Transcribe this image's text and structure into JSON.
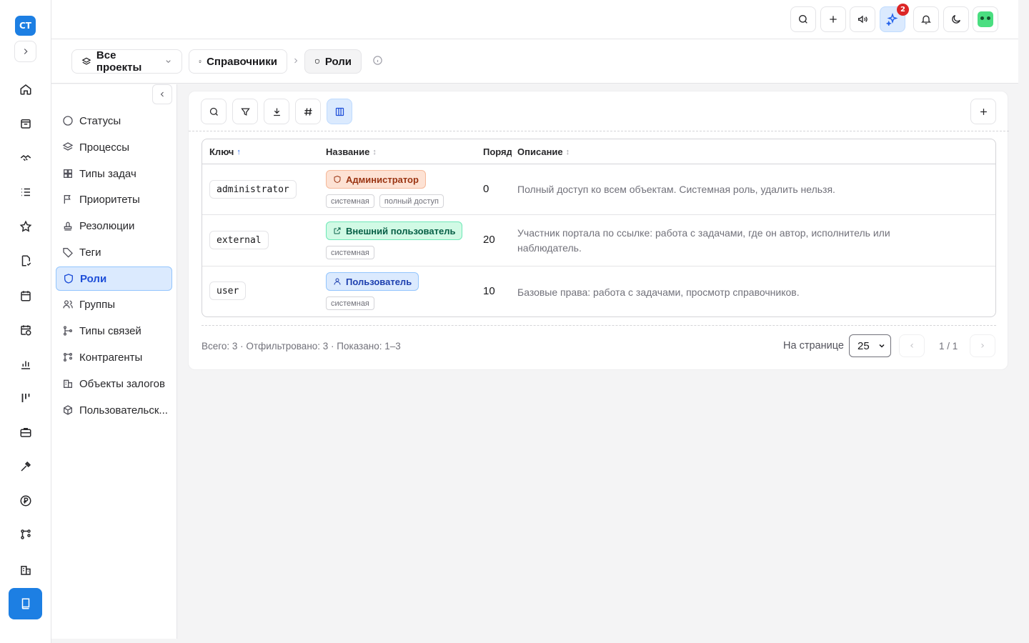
{
  "rail": {
    "logo": "CT",
    "icons": [
      "home-icon",
      "inbox-icon",
      "handshake-icon",
      "list-icon",
      "star-icon",
      "document-check-icon",
      "calendar-icon",
      "calendar-clock-icon",
      "bar-chart-icon",
      "kanban-icon",
      "briefcase-icon",
      "tools-icon",
      "ruble-icon",
      "nodes-icon",
      "building-icon"
    ],
    "active_icon": "book-icon"
  },
  "topbar": {
    "buttons": [
      "search-icon",
      "plus-icon",
      "megaphone-icon",
      "sparkles-icon",
      "bell-icon",
      "moon-icon"
    ],
    "ai_badge": "2"
  },
  "breadcrumb": {
    "projects": "Все проекты",
    "section": "Справочники",
    "current": "Роли"
  },
  "sidenav": {
    "items": [
      {
        "label": "Статусы",
        "icon": "circle-icon"
      },
      {
        "label": "Процессы",
        "icon": "layers-icon"
      },
      {
        "label": "Типы задач",
        "icon": "grid-icon"
      },
      {
        "label": "Приоритеты",
        "icon": "flag-icon"
      },
      {
        "label": "Резолюции",
        "icon": "stamp-icon"
      },
      {
        "label": "Теги",
        "icon": "tag-icon"
      },
      {
        "label": "Роли",
        "icon": "shield-icon",
        "active": true
      },
      {
        "label": "Группы",
        "icon": "users-icon"
      },
      {
        "label": "Типы связей",
        "icon": "git-branch-icon"
      },
      {
        "label": "Контрагенты",
        "icon": "nodes-icon"
      },
      {
        "label": "Объекты залогов",
        "icon": "building-icon"
      },
      {
        "label": "Пользовательск...",
        "icon": "box-icon"
      }
    ]
  },
  "table": {
    "headers": {
      "key": "Ключ",
      "name": "Название",
      "order": "Поряд",
      "desc": "Описание"
    },
    "rows": [
      {
        "key": "administrator",
        "name": "Администратор",
        "tags": [
          "системная",
          "полный доступ"
        ],
        "order": "0",
        "desc": "Полный доступ ко всем объектам. Системная роль, удалить нельзя.",
        "badge": "orange"
      },
      {
        "key": "external",
        "name": "Внешний пользователь",
        "tags": [
          "системная"
        ],
        "order": "20",
        "desc": "Участник портала по ссылке: работа с задачами, где он автор, исполнитель или наблюдатель.",
        "badge": "green"
      },
      {
        "key": "user",
        "name": "Пользователь",
        "tags": [
          "системная"
        ],
        "order": "10",
        "desc": "Базовые права: работа с задачами, просмотр справочников.",
        "badge": "blue"
      }
    ]
  },
  "footer": {
    "summary": "Всего: 3 · Отфильтровано: 3 · Показано: 1–3",
    "per_page_label": "На странице",
    "per_page_value": "25",
    "page_info": "1 / 1",
    "prev": "‹",
    "next": "›"
  },
  "colors": {
    "accent": "#1d7fe3",
    "active_bg": "#dbeafe",
    "admin_badge_bg": "#fde2d4",
    "admin_badge_fg": "#9a3412",
    "external_badge_bg": "#d1fae5",
    "external_badge_fg": "#065f46",
    "user_badge_bg": "#dbeafe",
    "user_badge_fg": "#1e40af"
  }
}
